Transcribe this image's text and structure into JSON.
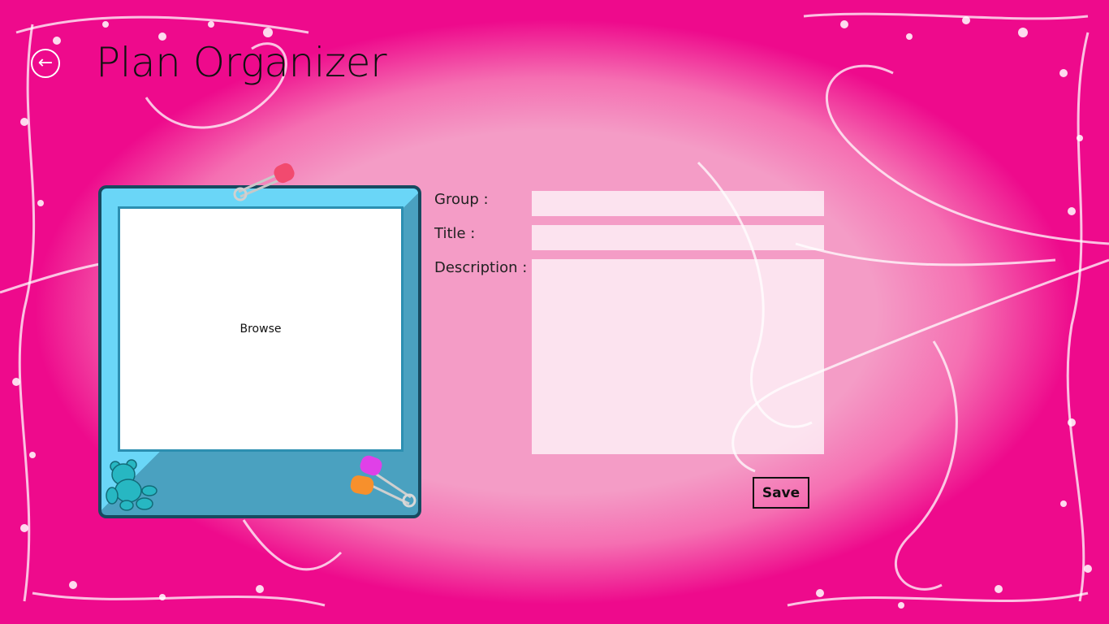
{
  "app": {
    "title": "Plan Organizer",
    "back_icon": "back-arrow-icon"
  },
  "image_frame": {
    "browse_label": "Browse"
  },
  "form": {
    "group_label": "Group :",
    "group_value": "",
    "title_label": "Title :",
    "title_value": "",
    "description_label": "Description :",
    "description_value": "",
    "save_label": "Save"
  },
  "colors": {
    "background": "#ee0a8c",
    "background_center": "#f49cc6",
    "frame_light": "#6ad6f7",
    "frame_dark": "#4aa1c0",
    "frame_border": "#174a60"
  }
}
